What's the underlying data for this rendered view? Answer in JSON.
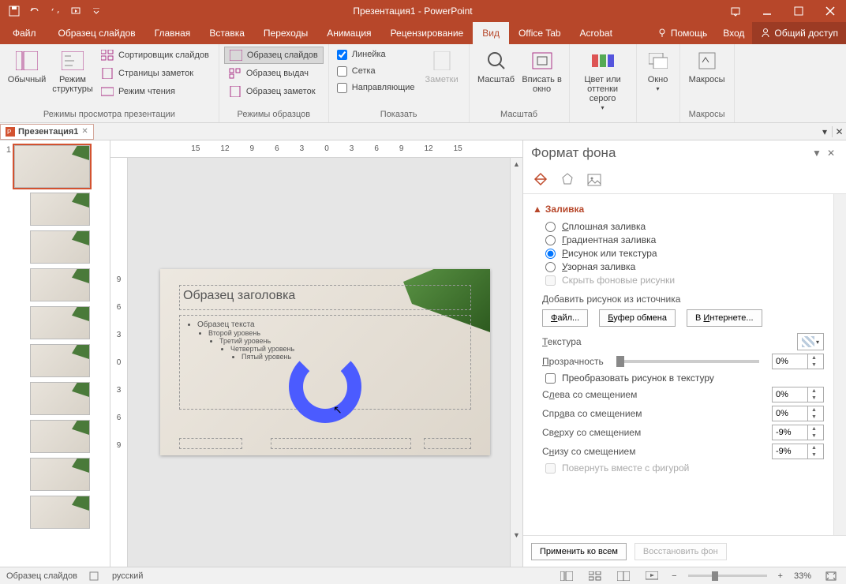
{
  "title": "Презентация1 - PowerPoint",
  "tabs": {
    "file": "Файл",
    "master": "Образец слайдов",
    "home": "Главная",
    "insert": "Вставка",
    "transitions": "Переходы",
    "animation": "Анимация",
    "review": "Рецензирование",
    "view": "Вид",
    "officetab": "Office Tab",
    "acrobat": "Acrobat",
    "help": "Помощь",
    "signin": "Вход",
    "share": "Общий доступ"
  },
  "ribbon": {
    "groups": {
      "pres_views": "Режимы просмотра презентации",
      "master_views": "Режимы образцов",
      "show": "Показать",
      "zoom": "Масштаб",
      "colorgray": "",
      "window": "",
      "macros": "Макросы"
    },
    "normal": "Обычный",
    "outline": "Режим структуры",
    "sorter": "Сортировщик слайдов",
    "notes_page": "Страницы заметок",
    "reading": "Режим чтения",
    "slide_master": "Образец слайдов",
    "handout_master": "Образец выдач",
    "notes_master": "Образец заметок",
    "ruler": "Линейка",
    "grid": "Сетка",
    "guides": "Направляющие",
    "notes": "Заметки",
    "zoom_btn": "Масштаб",
    "fit": "Вписать в окно",
    "color": "Цвет или оттенки серого",
    "window": "Окно",
    "macros": "Макросы"
  },
  "doctab": "Презентация1",
  "ruler_vals": [
    "15",
    "12",
    "9",
    "6",
    "3",
    "0",
    "3",
    "6",
    "9",
    "12",
    "15"
  ],
  "vruler_vals": [
    "9",
    "6",
    "3",
    "0",
    "3",
    "6",
    "9"
  ],
  "slide_num": "1",
  "slide": {
    "title_ph": "Образец заголовка",
    "body1": "Образец текста",
    "body2": "Второй уровень",
    "body3": "Третий уровень",
    "body4": "Четвертый уровень",
    "body5": "Пятый уровень"
  },
  "pane": {
    "title": "Формат фона",
    "section_fill": "Заливка",
    "solid": "Сплошная заливка",
    "gradient": "Градиентная заливка",
    "picture": "Рисунок или текстура",
    "pattern": "Узорная заливка",
    "hide_bg": "Скрыть фоновые рисунки",
    "insert_from": "Добавить рисунок из источника",
    "btn_file": "Файл...",
    "btn_clipboard": "Буфер обмена",
    "btn_online": "В Интернете...",
    "texture": "Текстура",
    "transparency": "Прозрачность",
    "transparency_val": "0%",
    "tile": "Преобразовать рисунок в текстуру",
    "offset_left": "Слева со смещением",
    "offset_right": "Справа со смещением",
    "offset_top": "Сверху со смещением",
    "offset_bottom": "Снизу со смещением",
    "val_left": "0%",
    "val_right": "0%",
    "val_top": "-9%",
    "val_bottom": "-9%",
    "rotate": "Повернуть вместе с фигурой",
    "apply_all": "Применить ко всем",
    "reset": "Восстановить фон"
  },
  "status": {
    "view": "Образец слайдов",
    "lang": "русский",
    "zoom": "33%"
  }
}
